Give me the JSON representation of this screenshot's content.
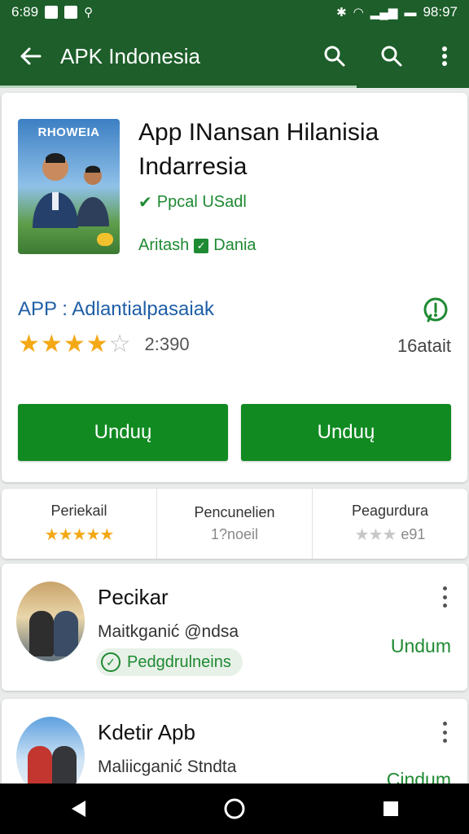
{
  "status_bar": {
    "left_text": "6:89",
    "time": "98:97"
  },
  "app_bar": {
    "title": "APK Indonesia",
    "icons": [
      "back-arrow-icon",
      "search-icon",
      "search-icon",
      "more-vert-icon"
    ],
    "background": "#1d5e2a"
  },
  "app": {
    "icon_brand_text": "RHOWEIA",
    "title": "App INansan Hilanisia Indarresia",
    "verified_label": "Ppcal USadl",
    "category_left": "Aritash",
    "category_right": "Dania",
    "developer": "APP : Adlantialpasaiak",
    "rating_stars": 4,
    "rating_max": 5,
    "rating_count": "2:390",
    "size": "16atait",
    "install_button_1": "Unduų",
    "install_button_2": "Unduų",
    "accent": "#118a22"
  },
  "stats": [
    {
      "label": "Periekail",
      "kind": "stars",
      "stars_filled": 5
    },
    {
      "label": "Pencunelien",
      "kind": "text",
      "value": "1?noeil"
    },
    {
      "label": "Peagurdura",
      "kind": "stars-grey",
      "stars_filled": 3,
      "value": "e91"
    }
  ],
  "list": [
    {
      "title": "Pecikar",
      "subtitle": "Maitkganić @ndsa",
      "chip": "Pedgdrulneins",
      "action": "Undum"
    },
    {
      "title": "Kdetir Apb",
      "subtitle": "Maliicganić Stndta",
      "action": "Cindum"
    }
  ],
  "nav": {
    "icons": [
      "back-triangle-icon",
      "home-circle-icon",
      "recents-square-icon"
    ]
  }
}
